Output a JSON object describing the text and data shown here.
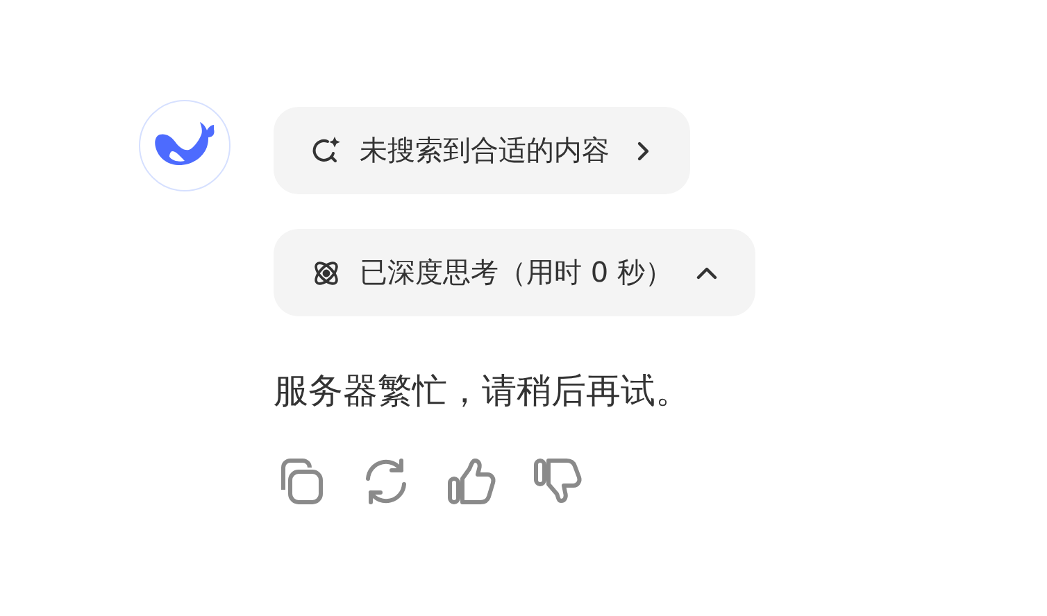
{
  "chips": [
    {
      "kind": "search",
      "label": "未搜索到合适的内容"
    },
    {
      "kind": "thinking",
      "label": "已深度思考（用时 0 秒）",
      "expanded": true
    }
  ],
  "message": "服务器繁忙，请稍后再试。",
  "actions": [
    {
      "kind": "copy"
    },
    {
      "kind": "regenerate"
    },
    {
      "kind": "like"
    },
    {
      "kind": "dislike"
    }
  ]
}
